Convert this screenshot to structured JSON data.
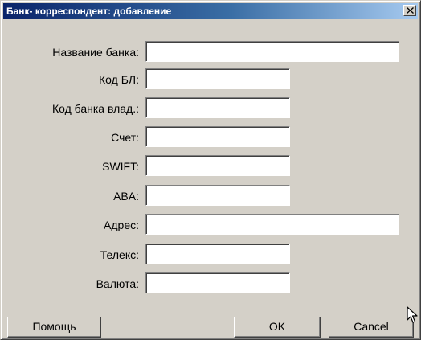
{
  "window": {
    "title": "Банк- корреспондент: добавление"
  },
  "form": {
    "bank_name_label": "Название банка:",
    "bank_name_value": "",
    "code_bl_label": "Код БЛ:",
    "code_bl_value": "",
    "owner_bank_code_label": "Код банка влад.:",
    "owner_bank_code_value": "",
    "account_label": "Счет:",
    "account_value": "",
    "swift_label": "SWIFT:",
    "swift_value": "",
    "aba_label": "ABA:",
    "aba_value": "",
    "address_label": "Адрес:",
    "address_value": "",
    "telex_label": "Телекс:",
    "telex_value": "",
    "currency_label": "Валюта:",
    "currency_value": ""
  },
  "buttons": {
    "help": "Помощь",
    "ok": "OK",
    "cancel": "Cancel"
  },
  "icons": {
    "close": "close-icon",
    "cursor": "mouse-pointer-icon"
  }
}
